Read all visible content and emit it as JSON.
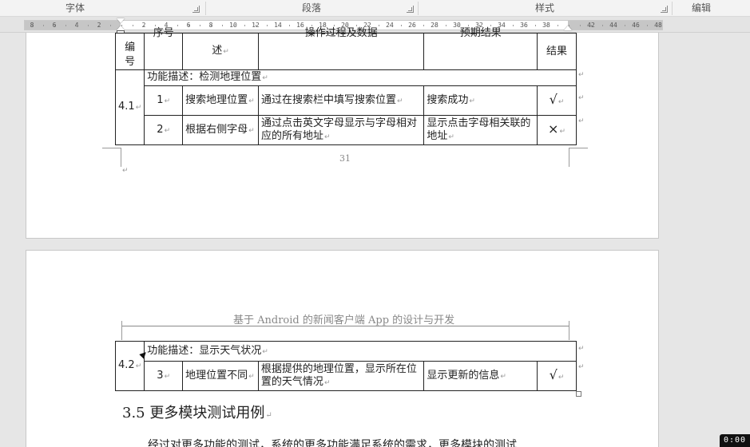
{
  "ribbon": {
    "groups": [
      {
        "label": "字体"
      },
      {
        "label": "段落"
      },
      {
        "label": "样式"
      },
      {
        "label": "编辑"
      }
    ]
  },
  "ruler": {
    "ticks": [
      "8",
      "6",
      "4",
      "2",
      "2",
      "4",
      "6",
      "8",
      "10",
      "12",
      "14",
      "16",
      "18",
      "20",
      "22",
      "24",
      "26",
      "28",
      "30",
      "32",
      "34",
      "36",
      "38",
      "42",
      "44",
      "46",
      "48"
    ]
  },
  "page1": {
    "header_row": {
      "col1": "编号",
      "col2": "序号",
      "col3": "述",
      "col4": "操作过程及数据",
      "col5": "预期结果",
      "col6": "结果"
    },
    "section_id": "4.1",
    "section_desc": "功能描述：检测地理位置",
    "rows": [
      {
        "num": "1",
        "item": "搜索地理位置",
        "steps": "通过在搜索栏中填写搜索位置",
        "expected": "搜索成功",
        "result": "√"
      },
      {
        "num": "2",
        "item": "根据右侧字母",
        "steps": "通过点击英文字母显示与字母相对应的所有地址",
        "expected": "显示点击字母相关联的地址",
        "result": "×"
      }
    ],
    "page_number": "31"
  },
  "page2": {
    "header": "基于 Android 的新闻客户端 App 的设计与开发",
    "section_id": "4.2",
    "section_desc": "功能描述：显示天气状况",
    "rows": [
      {
        "num": "3",
        "item": "地理位置不同",
        "steps": "根据提供的地理位置，显示所在位置的天气情况",
        "expected": "显示更新的信息",
        "result": "√"
      }
    ],
    "heading": "3.5  更多模块测试用例",
    "body_line": "经过对更多功能的测试，系统的更多功能满足系统的需求，更多模块的测试"
  },
  "timer": "0:00"
}
